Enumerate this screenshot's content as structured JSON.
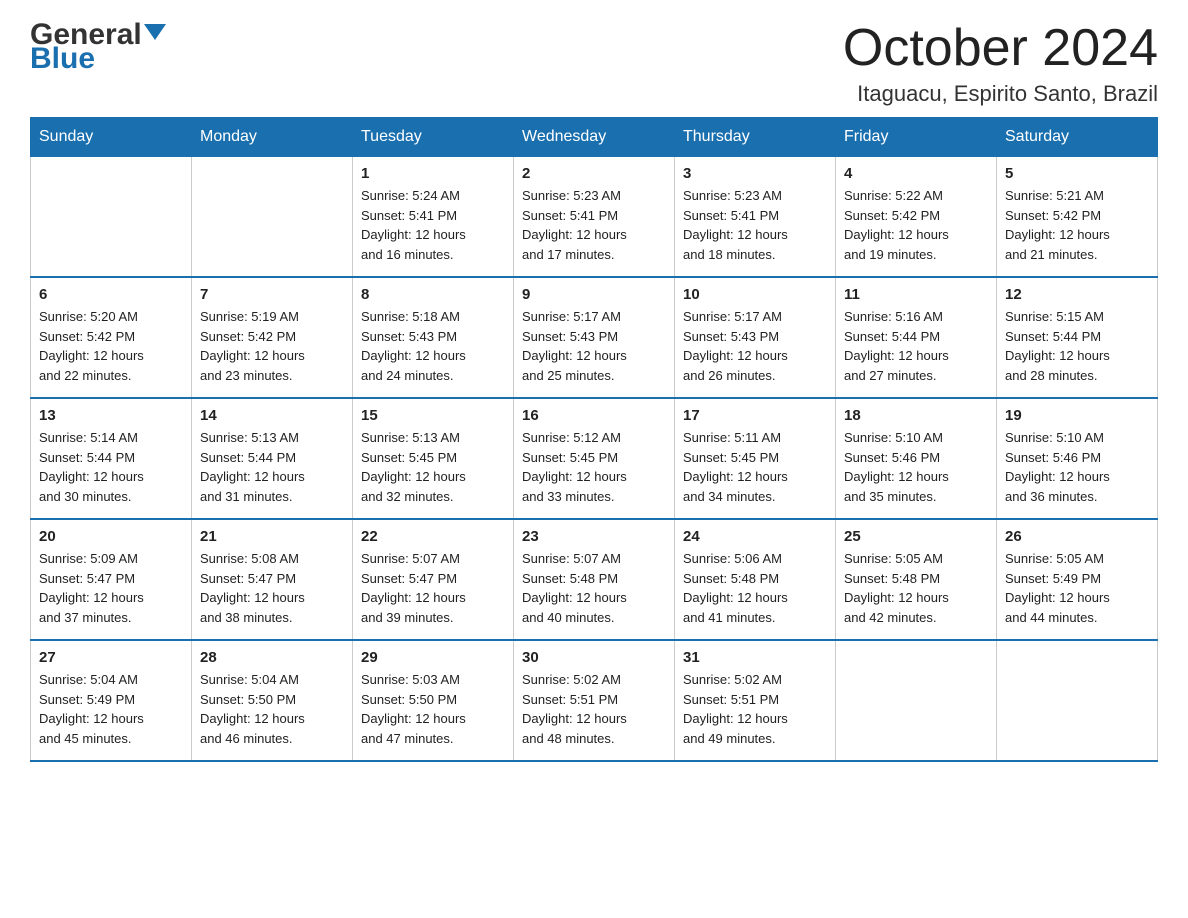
{
  "header": {
    "logo_general": "General",
    "logo_blue": "Blue",
    "month_title": "October 2024",
    "location": "Itaguacu, Espirito Santo, Brazil"
  },
  "days_of_week": [
    "Sunday",
    "Monday",
    "Tuesday",
    "Wednesday",
    "Thursday",
    "Friday",
    "Saturday"
  ],
  "weeks": [
    [
      {
        "day": "",
        "info": ""
      },
      {
        "day": "",
        "info": ""
      },
      {
        "day": "1",
        "info": "Sunrise: 5:24 AM\nSunset: 5:41 PM\nDaylight: 12 hours\nand 16 minutes."
      },
      {
        "day": "2",
        "info": "Sunrise: 5:23 AM\nSunset: 5:41 PM\nDaylight: 12 hours\nand 17 minutes."
      },
      {
        "day": "3",
        "info": "Sunrise: 5:23 AM\nSunset: 5:41 PM\nDaylight: 12 hours\nand 18 minutes."
      },
      {
        "day": "4",
        "info": "Sunrise: 5:22 AM\nSunset: 5:42 PM\nDaylight: 12 hours\nand 19 minutes."
      },
      {
        "day": "5",
        "info": "Sunrise: 5:21 AM\nSunset: 5:42 PM\nDaylight: 12 hours\nand 21 minutes."
      }
    ],
    [
      {
        "day": "6",
        "info": "Sunrise: 5:20 AM\nSunset: 5:42 PM\nDaylight: 12 hours\nand 22 minutes."
      },
      {
        "day": "7",
        "info": "Sunrise: 5:19 AM\nSunset: 5:42 PM\nDaylight: 12 hours\nand 23 minutes."
      },
      {
        "day": "8",
        "info": "Sunrise: 5:18 AM\nSunset: 5:43 PM\nDaylight: 12 hours\nand 24 minutes."
      },
      {
        "day": "9",
        "info": "Sunrise: 5:17 AM\nSunset: 5:43 PM\nDaylight: 12 hours\nand 25 minutes."
      },
      {
        "day": "10",
        "info": "Sunrise: 5:17 AM\nSunset: 5:43 PM\nDaylight: 12 hours\nand 26 minutes."
      },
      {
        "day": "11",
        "info": "Sunrise: 5:16 AM\nSunset: 5:44 PM\nDaylight: 12 hours\nand 27 minutes."
      },
      {
        "day": "12",
        "info": "Sunrise: 5:15 AM\nSunset: 5:44 PM\nDaylight: 12 hours\nand 28 minutes."
      }
    ],
    [
      {
        "day": "13",
        "info": "Sunrise: 5:14 AM\nSunset: 5:44 PM\nDaylight: 12 hours\nand 30 minutes."
      },
      {
        "day": "14",
        "info": "Sunrise: 5:13 AM\nSunset: 5:44 PM\nDaylight: 12 hours\nand 31 minutes."
      },
      {
        "day": "15",
        "info": "Sunrise: 5:13 AM\nSunset: 5:45 PM\nDaylight: 12 hours\nand 32 minutes."
      },
      {
        "day": "16",
        "info": "Sunrise: 5:12 AM\nSunset: 5:45 PM\nDaylight: 12 hours\nand 33 minutes."
      },
      {
        "day": "17",
        "info": "Sunrise: 5:11 AM\nSunset: 5:45 PM\nDaylight: 12 hours\nand 34 minutes."
      },
      {
        "day": "18",
        "info": "Sunrise: 5:10 AM\nSunset: 5:46 PM\nDaylight: 12 hours\nand 35 minutes."
      },
      {
        "day": "19",
        "info": "Sunrise: 5:10 AM\nSunset: 5:46 PM\nDaylight: 12 hours\nand 36 minutes."
      }
    ],
    [
      {
        "day": "20",
        "info": "Sunrise: 5:09 AM\nSunset: 5:47 PM\nDaylight: 12 hours\nand 37 minutes."
      },
      {
        "day": "21",
        "info": "Sunrise: 5:08 AM\nSunset: 5:47 PM\nDaylight: 12 hours\nand 38 minutes."
      },
      {
        "day": "22",
        "info": "Sunrise: 5:07 AM\nSunset: 5:47 PM\nDaylight: 12 hours\nand 39 minutes."
      },
      {
        "day": "23",
        "info": "Sunrise: 5:07 AM\nSunset: 5:48 PM\nDaylight: 12 hours\nand 40 minutes."
      },
      {
        "day": "24",
        "info": "Sunrise: 5:06 AM\nSunset: 5:48 PM\nDaylight: 12 hours\nand 41 minutes."
      },
      {
        "day": "25",
        "info": "Sunrise: 5:05 AM\nSunset: 5:48 PM\nDaylight: 12 hours\nand 42 minutes."
      },
      {
        "day": "26",
        "info": "Sunrise: 5:05 AM\nSunset: 5:49 PM\nDaylight: 12 hours\nand 44 minutes."
      }
    ],
    [
      {
        "day": "27",
        "info": "Sunrise: 5:04 AM\nSunset: 5:49 PM\nDaylight: 12 hours\nand 45 minutes."
      },
      {
        "day": "28",
        "info": "Sunrise: 5:04 AM\nSunset: 5:50 PM\nDaylight: 12 hours\nand 46 minutes."
      },
      {
        "day": "29",
        "info": "Sunrise: 5:03 AM\nSunset: 5:50 PM\nDaylight: 12 hours\nand 47 minutes."
      },
      {
        "day": "30",
        "info": "Sunrise: 5:02 AM\nSunset: 5:51 PM\nDaylight: 12 hours\nand 48 minutes."
      },
      {
        "day": "31",
        "info": "Sunrise: 5:02 AM\nSunset: 5:51 PM\nDaylight: 12 hours\nand 49 minutes."
      },
      {
        "day": "",
        "info": ""
      },
      {
        "day": "",
        "info": ""
      }
    ]
  ]
}
